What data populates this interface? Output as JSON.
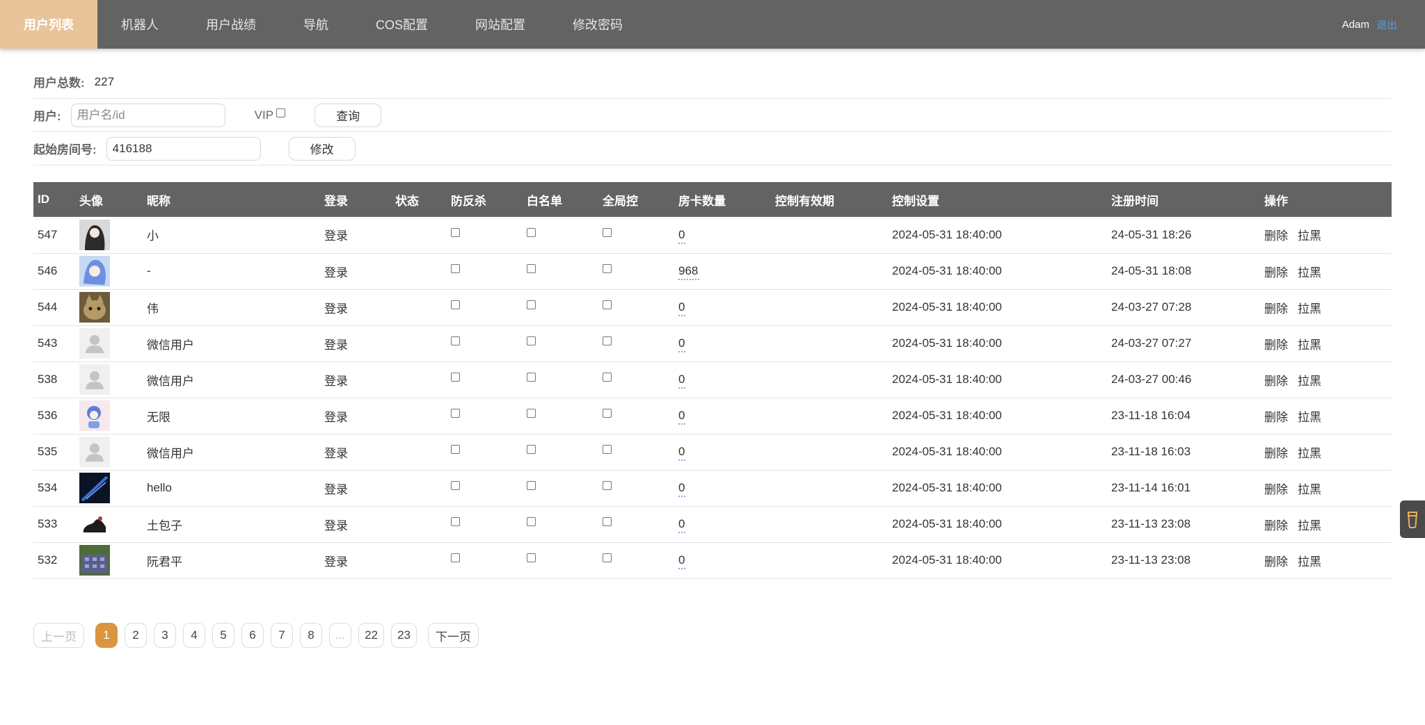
{
  "nav": {
    "items": [
      {
        "label": "用户列表",
        "active": true
      },
      {
        "label": "机器人",
        "active": false
      },
      {
        "label": "用户战绩",
        "active": false
      },
      {
        "label": "导航",
        "active": false
      },
      {
        "label": "COS配置",
        "active": false
      },
      {
        "label": "网站配置",
        "active": false
      },
      {
        "label": "修改密码",
        "active": false
      }
    ],
    "user": "Adam",
    "logout": "退出"
  },
  "summary": {
    "total_label": "用户总数:",
    "total_value": "227"
  },
  "search": {
    "user_label": "用户:",
    "placeholder": "用户名/id",
    "vip_label": "VIP",
    "query_button": "查询"
  },
  "room": {
    "label": "起始房间号:",
    "value": "416188",
    "modify_button": "修改"
  },
  "table": {
    "headers": {
      "id": "ID",
      "avatar": "头像",
      "nickname": "昵称",
      "login": "登录",
      "status": "状态",
      "anti_kill": "防反杀",
      "whitelist": "白名单",
      "global_ctrl": "全局控",
      "cards": "房卡数量",
      "ctrl_valid": "控制有效期",
      "ctrl_settings": "控制设置",
      "reg_time": "注册时间",
      "ops": "操作"
    },
    "rows": [
      {
        "id": "547",
        "avatar": "avatar-girl",
        "nickname": "小",
        "login": "登录",
        "cards": "0",
        "ctrl": "2024-05-31 18:40:00",
        "reg": "24-05-31 18:26"
      },
      {
        "id": "546",
        "avatar": "avatar-anime",
        "nickname": "-",
        "login": "登录",
        "cards": "968",
        "ctrl": "2024-05-31 18:40:00",
        "reg": "24-05-31 18:08"
      },
      {
        "id": "544",
        "avatar": "avatar-cat",
        "nickname": "伟",
        "login": "登录",
        "cards": "0",
        "ctrl": "2024-05-31 18:40:00",
        "reg": "24-03-27 07:28"
      },
      {
        "id": "543",
        "avatar": "avatar-default",
        "nickname": "微信用户",
        "login": "登录",
        "cards": "0",
        "ctrl": "2024-05-31 18:40:00",
        "reg": "24-03-27 07:27"
      },
      {
        "id": "538",
        "avatar": "avatar-default",
        "nickname": "微信用户",
        "login": "登录",
        "cards": "0",
        "ctrl": "2024-05-31 18:40:00",
        "reg": "24-03-27 00:46"
      },
      {
        "id": "536",
        "avatar": "avatar-cartoon",
        "nickname": "无限",
        "login": "登录",
        "cards": "0",
        "ctrl": "2024-05-31 18:40:00",
        "reg": "23-11-18 16:04"
      },
      {
        "id": "535",
        "avatar": "avatar-default",
        "nickname": "微信用户",
        "login": "登录",
        "cards": "0",
        "ctrl": "2024-05-31 18:40:00",
        "reg": "23-11-18 16:03"
      },
      {
        "id": "534",
        "avatar": "avatar-dark",
        "nickname": "hello",
        "login": "登录",
        "cards": "0",
        "ctrl": "2024-05-31 18:40:00",
        "reg": "23-11-14 16:01"
      },
      {
        "id": "533",
        "avatar": "avatar-ink",
        "nickname": "土包子",
        "login": "登录",
        "cards": "0",
        "ctrl": "2024-05-31 18:40:00",
        "reg": "23-11-13 23:08"
      },
      {
        "id": "532",
        "avatar": "avatar-building",
        "nickname": "阮君平",
        "login": "登录",
        "cards": "0",
        "ctrl": "2024-05-31 18:40:00",
        "reg": "23-11-13 23:08"
      }
    ],
    "delete_label": "删除",
    "block_label": "拉黑"
  },
  "pagination": {
    "prev": "上一页",
    "next": "下一页",
    "pages": [
      "1",
      "2",
      "3",
      "4",
      "5",
      "6",
      "7",
      "8",
      "...",
      "22",
      "23"
    ],
    "current": "1"
  },
  "colors": {
    "nav_bg": "#636363",
    "nav_active": "#e8c49a",
    "pager_active": "#d9953f",
    "logout": "#5b9bd5"
  },
  "side_widget_icon": "cup-icon"
}
